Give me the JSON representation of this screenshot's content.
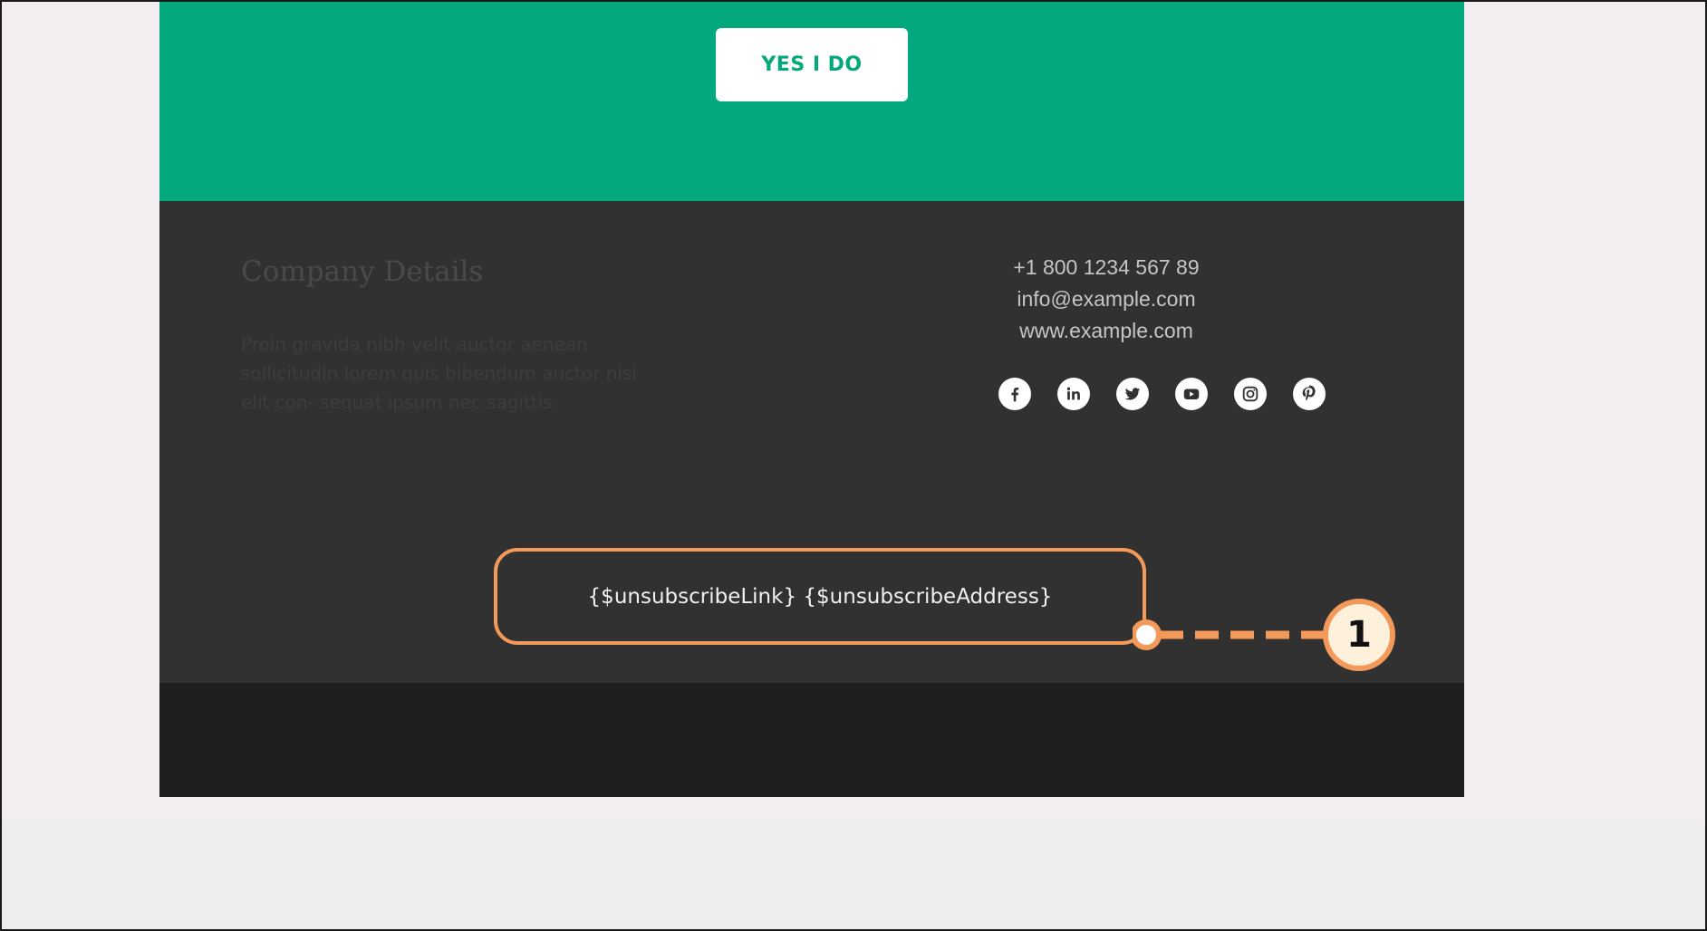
{
  "hero": {
    "button_label": "YES I DO",
    "background_color": "#03a87c"
  },
  "footer": {
    "company_title": "Company Details",
    "company_description": "Proin gravida nibh velit auctor aenean sollicitudin lorem quis bibendum auctor nisi elit con- sequat ipsum nec sagittis",
    "phone": "+1 800 1234 567 89",
    "email": "info@example.com",
    "website": "www.example.com",
    "social_icons": [
      "facebook-icon",
      "linkedin-icon",
      "twitter-icon",
      "youtube-icon",
      "instagram-icon",
      "pinterest-icon"
    ],
    "unsubscribe_text": "{$unsubscribeLink} {$unsubscribeAddress}"
  },
  "annotation": {
    "callout_number": "1",
    "highlight_color": "#f39a5a"
  }
}
